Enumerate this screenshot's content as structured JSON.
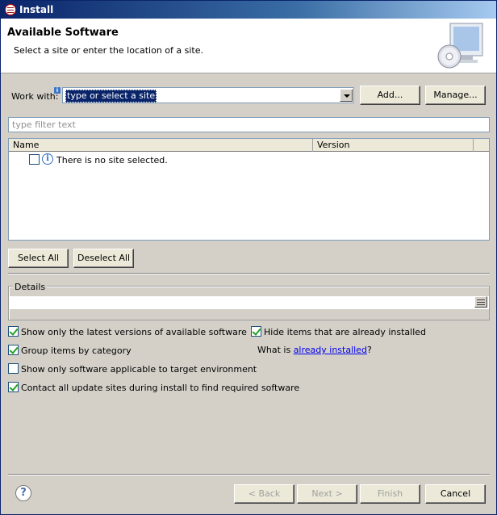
{
  "window": {
    "title": "Install"
  },
  "banner": {
    "heading": "Available Software",
    "description": "Select a site or enter the location of a site."
  },
  "work_with": {
    "label": "Work with:",
    "value": "type or select a site",
    "add_button": "Add...",
    "manage_button": "Manage..."
  },
  "filter": {
    "placeholder": "type filter text"
  },
  "table": {
    "columns": [
      "Name",
      "Version"
    ],
    "rows": [
      {
        "name": "There is no site selected.",
        "version": "",
        "checked": false
      }
    ]
  },
  "selection_buttons": {
    "select_all": "Select All",
    "deselect_all": "Deselect All"
  },
  "details": {
    "label": "Details",
    "text": ""
  },
  "options": {
    "show_latest": {
      "label": "Show only the latest versions of available software",
      "checked": true
    },
    "group_by_category": {
      "label": "Group items by category",
      "checked": true
    },
    "applicable_only": {
      "label": "Show only software applicable to target environment",
      "checked": false
    },
    "contact_all_sites": {
      "label": "Contact all update sites during install to find required software",
      "checked": true
    },
    "hide_installed": {
      "label": "Hide items that are already installed",
      "checked": true
    },
    "what_is_prefix": "What is ",
    "what_is_link": "already installed",
    "what_is_suffix": "?"
  },
  "footer": {
    "help_glyph": "?",
    "back": "< Back",
    "next": "Next >",
    "finish": "Finish",
    "cancel": "Cancel"
  },
  "icons": {
    "window": "eclipse-icon",
    "banner": "install-cd-monitor-icon",
    "info": "info-icon",
    "help": "help-icon"
  }
}
